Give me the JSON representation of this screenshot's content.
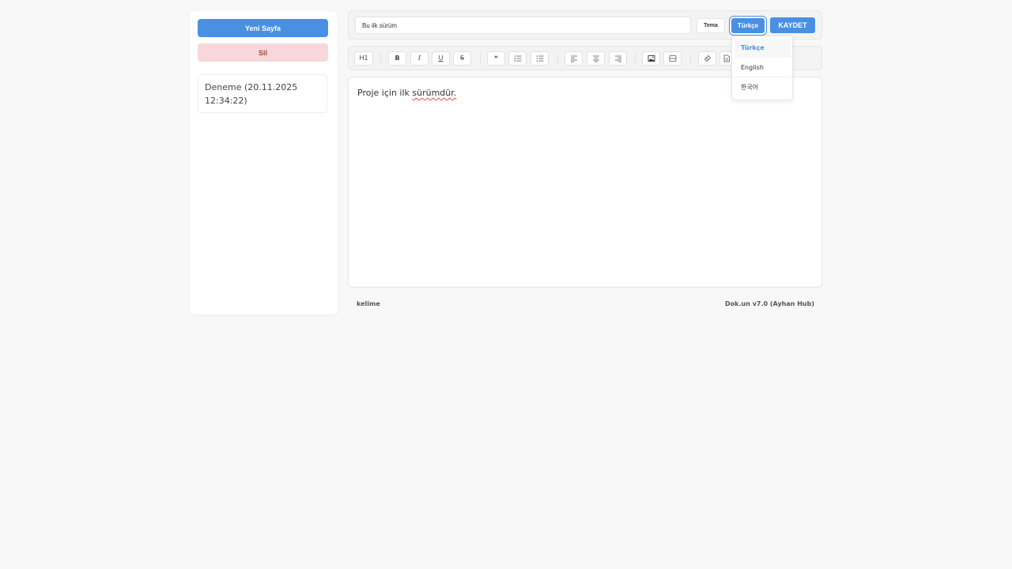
{
  "sidebar": {
    "new_page_label": "Yeni Sayfa",
    "delete_label": "Sil",
    "pages": [
      {
        "title": "Deneme (20.11.2025 12:34:22)"
      }
    ]
  },
  "header": {
    "title_value": "Bu ilk sürüm",
    "theme_label": "Tema",
    "language_label": "Türkçe",
    "save_label": "KAYDET"
  },
  "toolbar": {
    "heading_label": "H1",
    "bold_label": "B",
    "italic_label": "I",
    "underline_label": "U",
    "strike_label": "S",
    "quote_label": "❝",
    "icons": [
      "heading-icon",
      "bold-icon",
      "italic-icon",
      "underline-icon",
      "strikethrough-icon",
      "quote-icon",
      "bullet-list-icon",
      "numbered-list-icon",
      "align-left-icon",
      "align-center-icon",
      "align-right-icon",
      "image-icon",
      "table-icon",
      "eraser-icon",
      "document-icon"
    ]
  },
  "editor": {
    "text_before": "Proje için ilk ",
    "text_misspelled": "sürümdür."
  },
  "footer": {
    "word_count_label": "kelime",
    "version_label": "Dok.un v7.0 (Ayhan Hub)"
  },
  "language_menu": {
    "options": [
      {
        "label": "Türkçe",
        "active": true
      },
      {
        "label": "English",
        "active": false
      },
      {
        "label": "한국어",
        "active": false
      }
    ]
  },
  "colors": {
    "accent": "#4a90e2",
    "danger_bg": "#f8d7da",
    "danger_text": "#a94442"
  }
}
